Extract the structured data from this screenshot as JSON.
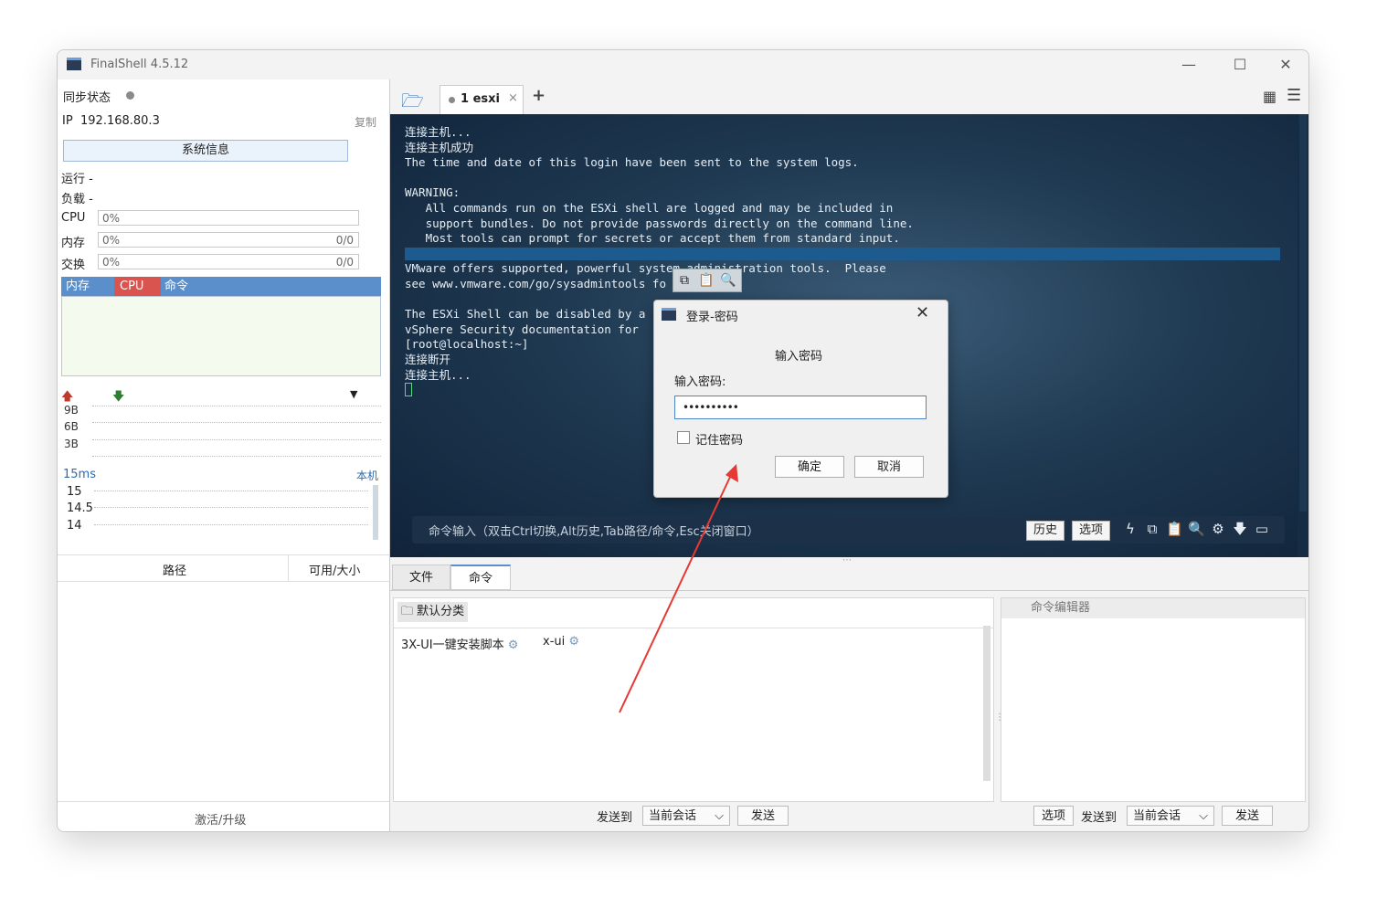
{
  "window": {
    "title": "FinalShell 4.5.12"
  },
  "left": {
    "sync_label": "同步状态",
    "ip_label": "IP",
    "ip_value": "192.168.80.3",
    "copy_label": "复制",
    "sysinfo_button": "系统信息",
    "run_label": "运行 -",
    "load_label": "负载 -",
    "cpu_label": "CPU",
    "cpu_value": "0%",
    "mem_label": "内存",
    "mem_value": "0%",
    "mem_right": "0/0",
    "swap_label": "交换",
    "swap_value": "0%",
    "swap_right": "0/0",
    "proc_tabs": [
      "内存",
      "CPU",
      "命令"
    ],
    "net_ticks": [
      "9B",
      "6B",
      "3B"
    ],
    "ping_label": "15ms",
    "ping_target": "本机",
    "ping_ticks": [
      "15",
      "14.5",
      "14"
    ],
    "path_col": "路径",
    "size_col": "可用/大小",
    "activate": "激活/升级"
  },
  "tabs": {
    "session_tab": "1 esxi"
  },
  "terminal": {
    "lines": [
      "连接主机...",
      "连接主机成功",
      "The time and date of this login have been sent to the system logs.",
      "",
      "WARNING:",
      "   All commands run on the ESXi shell are logged and may be included in",
      "   support bundles. Do not provide passwords directly on the command line.",
      "   Most tools can prompt for secrets or accept them from standard input.",
      "",
      "VMware offers supported, powerful system administration tools.  Please",
      "see www.vmware.com/go/sysadmintools fo",
      "",
      "The ESXi Shell can be disabled by a",
      "vSphere Security documentation for",
      "[root@localhost:~]",
      "连接断开",
      "连接主机..."
    ],
    "cmd_placeholder": "命令输入（双击Ctrl切换,Alt历史,Tab路径/命令,Esc关闭窗口）",
    "history_button": "历史",
    "options_button": "选项"
  },
  "bottom": {
    "tab_files": "文件",
    "tab_commands": "命令",
    "category": "默认分类",
    "commands": [
      "3X-UI一键安装脚本",
      "x-ui"
    ],
    "editor_title": "命令编辑器",
    "send_to": "发送到",
    "current_session": "当前会话",
    "send": "发送",
    "options": "选项"
  },
  "dialog": {
    "title": "登录-密码",
    "heading": "输入密码",
    "field_label": "输入密码:",
    "password_value": "••••••••••",
    "remember": "记住密码",
    "ok": "确定",
    "cancel": "取消"
  },
  "colors": {
    "accent": "#5a8fcc",
    "cpu_tab": "#d9534f",
    "arrow": "#e53935"
  }
}
